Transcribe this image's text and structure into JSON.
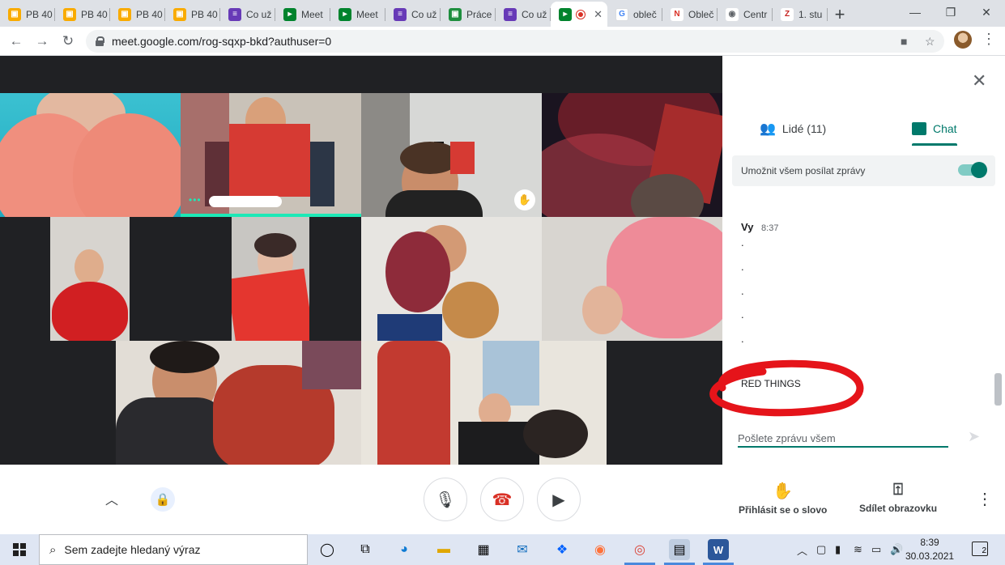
{
  "browser": {
    "tabs": [
      {
        "label": "PB 40",
        "icon": "google-classroom-icon",
        "color": "#f9ab00"
      },
      {
        "label": "PB 40",
        "icon": "google-classroom-icon",
        "color": "#f9ab00"
      },
      {
        "label": "PB 40",
        "icon": "google-classroom-icon",
        "color": "#f9ab00"
      },
      {
        "label": "PB 40",
        "icon": "google-classroom-icon",
        "color": "#f9ab00"
      },
      {
        "label": "Co už",
        "icon": "google-forms-icon",
        "color": "#673ab7"
      },
      {
        "label": "Meet",
        "icon": "google-meet-icon",
        "color": "#00832d"
      },
      {
        "label": "Meet",
        "icon": "google-meet-icon",
        "color": "#00832d"
      },
      {
        "label": "Co už",
        "icon": "google-forms-icon",
        "color": "#673ab7"
      },
      {
        "label": "Práce",
        "icon": "google-classroom-icon",
        "color": "#1e8e3e"
      },
      {
        "label": "Co už",
        "icon": "google-forms-icon",
        "color": "#673ab7"
      },
      {
        "label": "",
        "icon": "google-meet-icon",
        "color": "#00832d",
        "active": true
      },
      {
        "label": "obleč",
        "icon": "google-icon",
        "color": "#4285f4"
      },
      {
        "label": "Obleč",
        "icon": "red-bookmark-icon",
        "color": "#d93025"
      },
      {
        "label": "Centr",
        "icon": "globe-icon",
        "color": "#5f6368"
      },
      {
        "label": "1. stu",
        "icon": "red-logo-icon",
        "color": "#c5221f"
      }
    ],
    "new_tab_label": "+",
    "url": "meet.google.com/rog-sqxp-bkd?authuser=0"
  },
  "panel": {
    "close_icon": "close-icon",
    "people_label": "Lidé (11)",
    "chat_label": "Chat",
    "allow_label": "Umožnit všem posílat zprávy",
    "allow_enabled": true,
    "message": {
      "sender": "Vy",
      "time": "8:37",
      "lines": [
        ".",
        ".",
        ".",
        ".",
        "."
      ],
      "highlight": "RED THINGS"
    },
    "input_placeholder": "Pošlete zprávu všem",
    "accent_color": "#00796b"
  },
  "controls": {
    "raise_hand_label": "Přihlásit se o slovo",
    "share_screen_label": "Sdílet obrazovku"
  },
  "taskbar": {
    "search_placeholder": "Sem zadejte hledaný výraz",
    "time": "8:39",
    "date": "30.03.2021",
    "notification_count": "2"
  }
}
